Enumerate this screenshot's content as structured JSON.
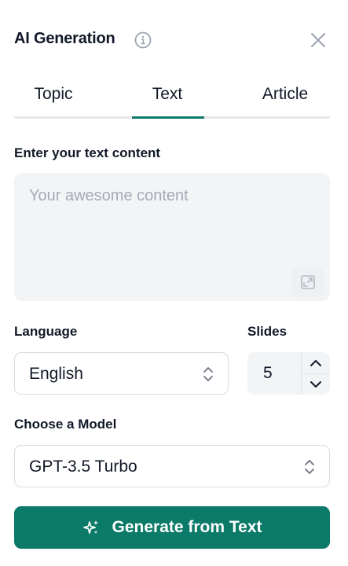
{
  "header": {
    "title": "AI Generation"
  },
  "tabs": [
    {
      "label": "Topic",
      "active": false
    },
    {
      "label": "Text",
      "active": true
    },
    {
      "label": "Article",
      "active": false
    }
  ],
  "content": {
    "label": "Enter your text content",
    "placeholder": "Your awesome content",
    "value": ""
  },
  "language": {
    "label": "Language",
    "selected": "English"
  },
  "slides": {
    "label": "Slides",
    "value": "5"
  },
  "model": {
    "label": "Choose a Model",
    "selected": "GPT-3.5 Turbo"
  },
  "generate": {
    "label": "Generate from Text"
  },
  "colors": {
    "accent": "#0c7a68",
    "field_bg": "#f3f4f6",
    "border": "#d8dbe0"
  },
  "icons": {
    "info": "info-icon",
    "close": "close-icon",
    "expand": "expand-icon",
    "chevron_updown": "chevron-updown-icon",
    "chevron_up": "chevron-up-icon",
    "chevron_down": "chevron-down-icon",
    "sparkles": "sparkles-icon"
  }
}
